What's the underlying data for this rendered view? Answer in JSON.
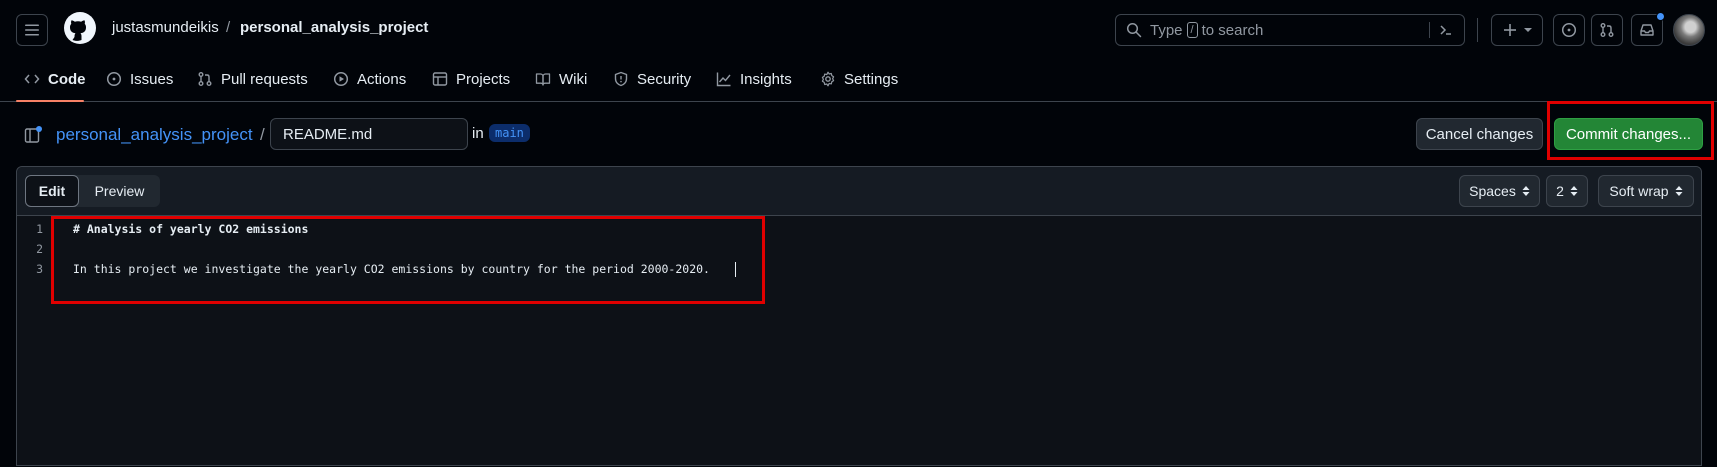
{
  "header": {
    "owner": "justasmundeikis",
    "separator": "/",
    "repo": "personal_analysis_project",
    "search_placeholder_prefix": "Type",
    "search_key": "/",
    "search_placeholder_suffix": "to search",
    "avatar": "user-avatar"
  },
  "tabs": [
    {
      "label": "Code",
      "icon": "code-icon"
    },
    {
      "label": "Issues",
      "icon": "issue-icon"
    },
    {
      "label": "Pull requests",
      "icon": "pull-request-icon"
    },
    {
      "label": "Actions",
      "icon": "play-icon"
    },
    {
      "label": "Projects",
      "icon": "table-icon"
    },
    {
      "label": "Wiki",
      "icon": "book-icon"
    },
    {
      "label": "Security",
      "icon": "shield-icon"
    },
    {
      "label": "Insights",
      "icon": "graph-icon"
    },
    {
      "label": "Settings",
      "icon": "gear-icon"
    }
  ],
  "filebar": {
    "repo_link": "personal_analysis_project",
    "slash": "/",
    "filename": "README.md",
    "in_label": "in",
    "branch": "main",
    "cancel_label": "Cancel changes",
    "commit_label": "Commit changes..."
  },
  "editor": {
    "edit_tab": "Edit",
    "preview_tab": "Preview",
    "indent_mode": "Spaces",
    "indent_size": "2",
    "wrap_mode": "Soft wrap",
    "lines": [
      {
        "num": "1",
        "text": "# Analysis of yearly CO2 emissions"
      },
      {
        "num": "2",
        "text": ""
      },
      {
        "num": "3",
        "text": "In this project we investigate the yearly CO2 emissions by country for the period 2000-2020."
      }
    ]
  },
  "colors": {
    "background": "#010409",
    "editor_bg": "#0d1117",
    "link": "#4493f8",
    "commit_green": "#238636",
    "highlight_red": "#e00000",
    "tab_underline": "#f78166"
  }
}
